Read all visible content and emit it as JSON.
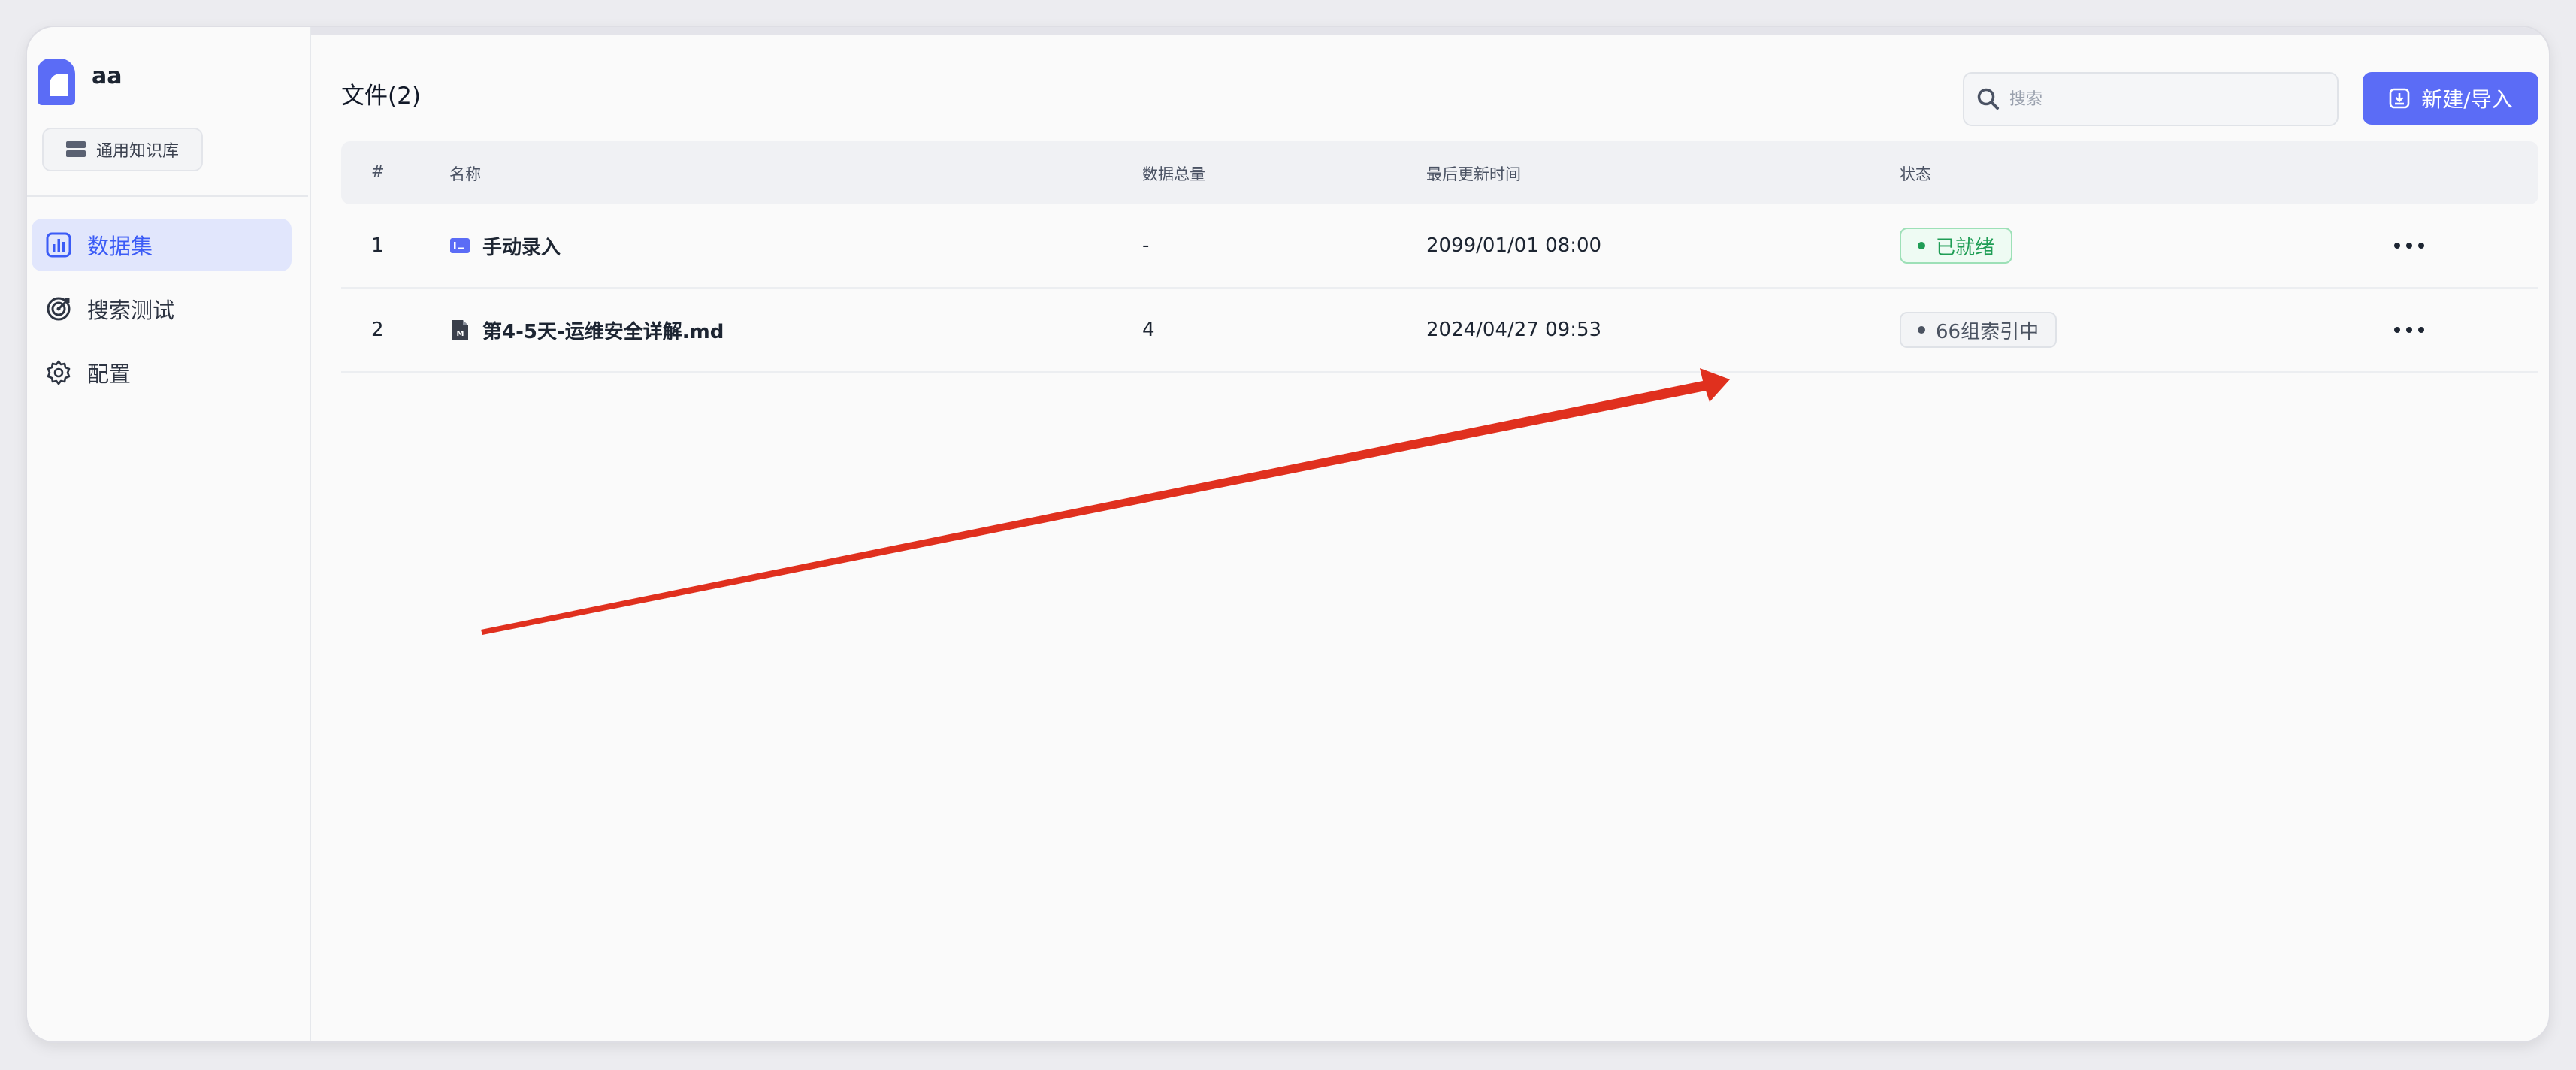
{
  "sidebar": {
    "kb_name": "aa",
    "kb_type": "通用知识库",
    "nav": [
      {
        "label": "数据集",
        "icon": "bar-chart-icon",
        "active": true
      },
      {
        "label": "搜索测试",
        "icon": "target-icon",
        "active": false
      },
      {
        "label": "配置",
        "icon": "gear-icon",
        "active": false
      }
    ]
  },
  "header": {
    "title": "文件(2)",
    "search_placeholder": "搜索",
    "new_button_label": "新建/导入"
  },
  "table": {
    "columns": [
      "#",
      "名称",
      "数据总量",
      "最后更新时间",
      "状态"
    ],
    "rows": [
      {
        "index": "1",
        "name": "手动录入",
        "icon": "manual-entry-icon",
        "count": "-",
        "updated": "2099/01/01 08:00",
        "status": "已就绪",
        "status_type": "ready"
      },
      {
        "index": "2",
        "name": "第4-5天-运维安全详解.md",
        "icon": "markdown-file-icon",
        "count": "4",
        "updated": "2024/04/27 09:53",
        "status": "66组索引中",
        "status_type": "indexing"
      }
    ]
  },
  "colors": {
    "accent": "#5b6cf6",
    "ready": "#1f9d55",
    "annotation_arrow": "#e0301e"
  }
}
